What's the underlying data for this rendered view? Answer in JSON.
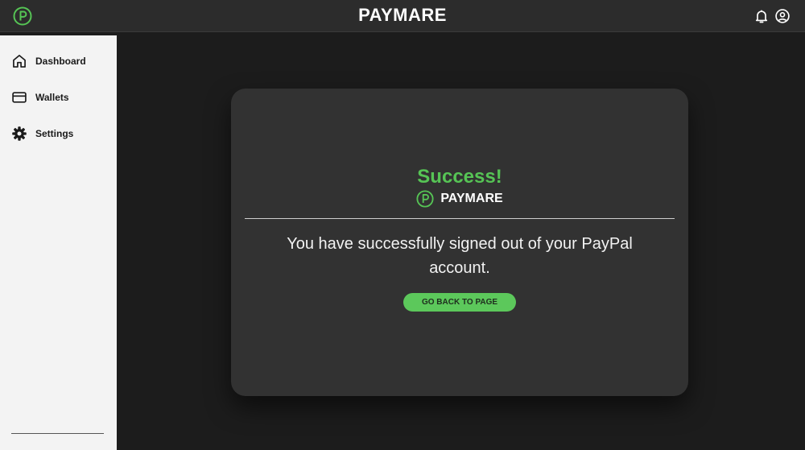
{
  "header": {
    "title": "PAYMARE",
    "logo_icon": "paymare-p-logo-icon",
    "notification_icon": "bell-icon",
    "account_icon": "user-circle-icon"
  },
  "sidebar": {
    "items": [
      {
        "label": "Dashboard",
        "icon": "home-icon"
      },
      {
        "label": "Wallets",
        "icon": "credit-card-icon"
      },
      {
        "label": "Settings",
        "icon": "gear-icon"
      }
    ]
  },
  "dialog": {
    "title": "Success!",
    "brand": "PAYMARE",
    "message": "You have successfully signed out of your PayPal account.",
    "button_label": "GO BACK TO PAGE"
  },
  "colors": {
    "accent": "#56c455",
    "topbar": "#2c2c2c",
    "background": "#1c1c1c",
    "card": "#323232",
    "sidebar": "#f3f3f3"
  }
}
